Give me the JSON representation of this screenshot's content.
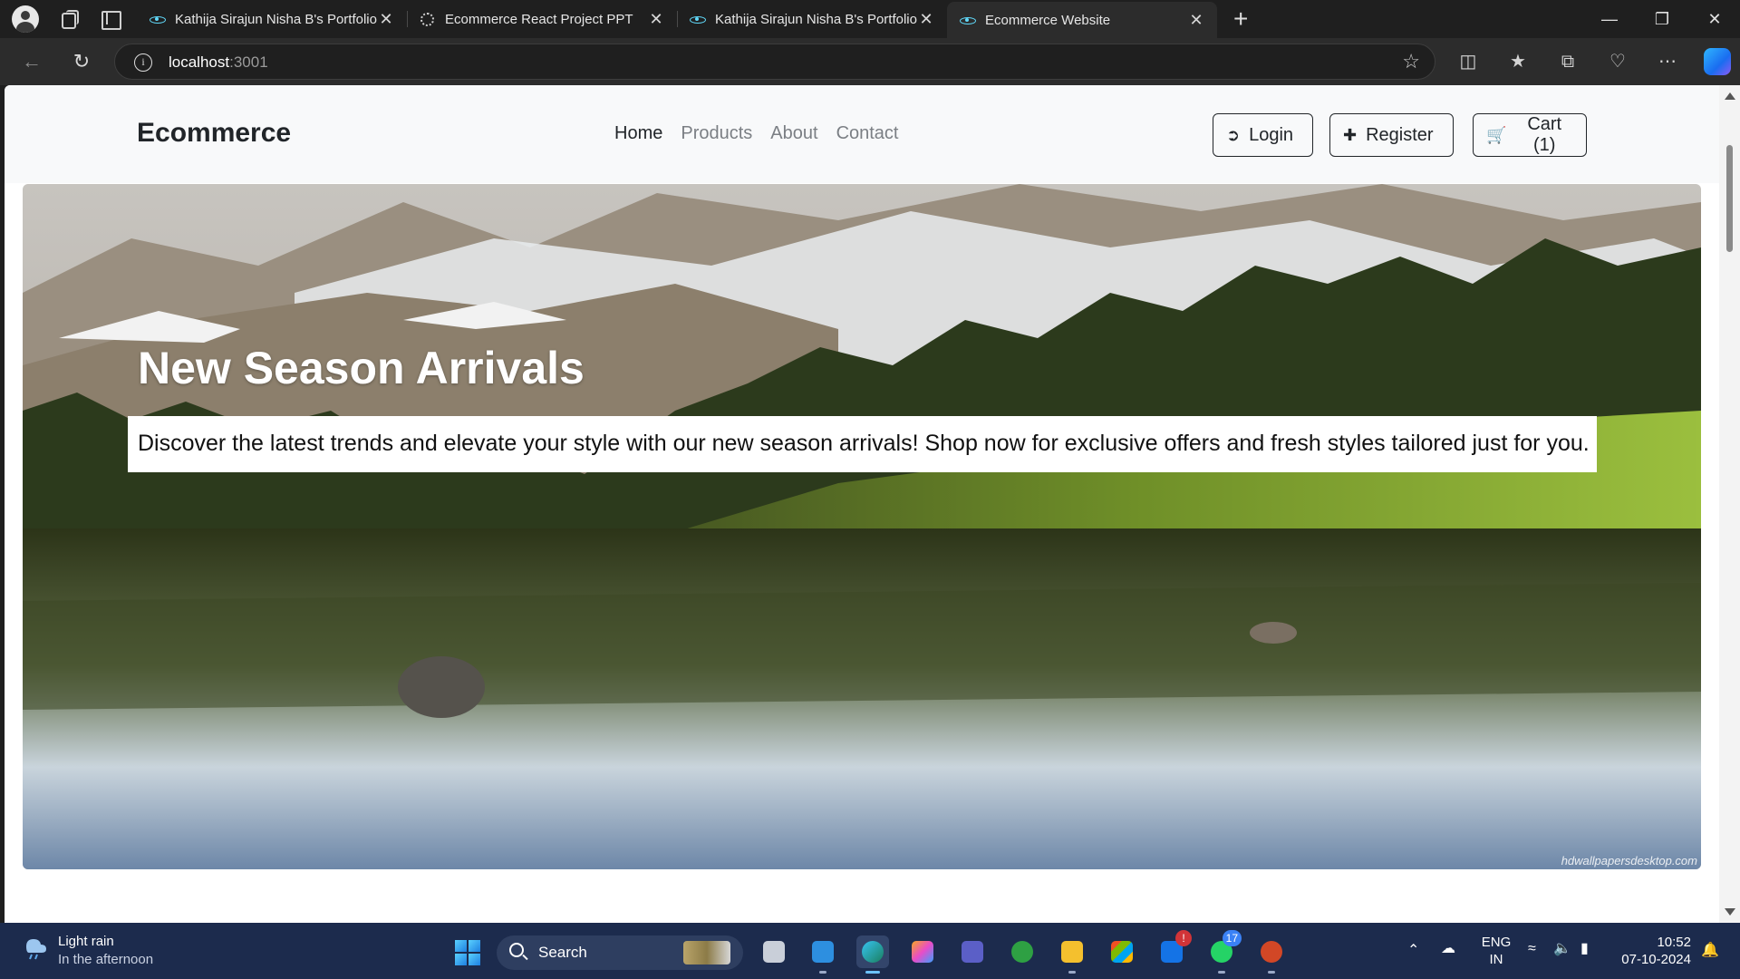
{
  "browser": {
    "tabs": [
      {
        "title": "Kathija Sirajun Nisha B's Portfolio",
        "favicon": "react-icon",
        "active": false
      },
      {
        "title": "Ecommerce React Project PPT",
        "favicon": "chatgpt-icon",
        "active": false
      },
      {
        "title": "Kathija Sirajun Nisha B's Portfolio",
        "favicon": "react-icon",
        "active": false
      },
      {
        "title": "Ecommerce Website",
        "favicon": "react-icon",
        "active": true
      }
    ],
    "close_glyph": "✕",
    "new_tab_glyph": "+",
    "address": {
      "host": "localhost",
      "port": ":3001"
    }
  },
  "site": {
    "brand": "Ecommerce",
    "nav": [
      "Home",
      "Products",
      "About",
      "Contact"
    ],
    "active_nav": "Home",
    "buttons": {
      "login": "Login",
      "register": "Register",
      "cart": "Cart (1)"
    },
    "hero": {
      "title": "New Season Arrivals",
      "text": "Discover the latest trends and elevate your style with our new season arrivals! Shop now for exclusive offers and fresh styles tailored just for you.",
      "watermark": "hdwallpapersdesktop.com"
    }
  },
  "taskbar": {
    "weather": {
      "condition": "Light rain",
      "detail": "In the afternoon"
    },
    "search_label": "Search",
    "apps": [
      {
        "name": "task-view",
        "badge": ""
      },
      {
        "name": "vscode",
        "badge": ""
      },
      {
        "name": "edge",
        "badge": ""
      },
      {
        "name": "copilot",
        "badge": ""
      },
      {
        "name": "teams",
        "badge": ""
      },
      {
        "name": "xbox",
        "badge": ""
      },
      {
        "name": "file-explorer",
        "badge": ""
      },
      {
        "name": "microsoft-store",
        "badge": ""
      },
      {
        "name": "outlook",
        "badge": "!"
      },
      {
        "name": "whatsapp",
        "badge": "17"
      },
      {
        "name": "powerpoint",
        "badge": ""
      }
    ],
    "language": {
      "line1": "ENG",
      "line2": "IN"
    },
    "time": "10:52",
    "date": "07-10-2024"
  },
  "colors": {
    "tab_strip": "#1f1f1f",
    "taskbar": "#1c2b4d",
    "navbar": "#f8f9fa",
    "text_dark": "#212529",
    "nav_muted": "#7b7f84"
  }
}
